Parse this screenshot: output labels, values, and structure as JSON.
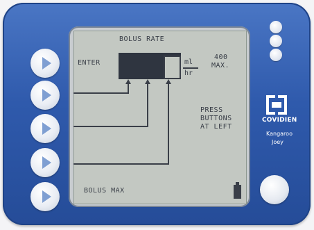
{
  "screen": {
    "title": "BOLUS RATE",
    "enter_label": "ENTER",
    "max_value": "400",
    "max_label": "MAX.",
    "unit_top": "ml",
    "unit_bottom": "hr",
    "press_lines": [
      "PRESS",
      "BUTTONS",
      "AT LEFT"
    ],
    "footer_label": "BOLUS MAX"
  },
  "brand": {
    "company": "COVIDIEN",
    "product_line1": "Kangaroo",
    "product_line2": "Joey"
  },
  "icons": {
    "side_buttons": [
      "play-icon",
      "play-icon",
      "play-icon",
      "play-icon",
      "play-icon"
    ],
    "battery": "battery-icon",
    "logo": "covidien-logo-icon",
    "power": "power-button-icon",
    "indicators": [
      "indicator-dot-icon",
      "indicator-dot-icon",
      "indicator-dot-icon"
    ]
  },
  "colors": {
    "panel_blue": "#2f5aac",
    "lcd_bg": "#c3c8c2",
    "lcd_ink": "#3a3f48",
    "button_white": "#e9edf4"
  }
}
